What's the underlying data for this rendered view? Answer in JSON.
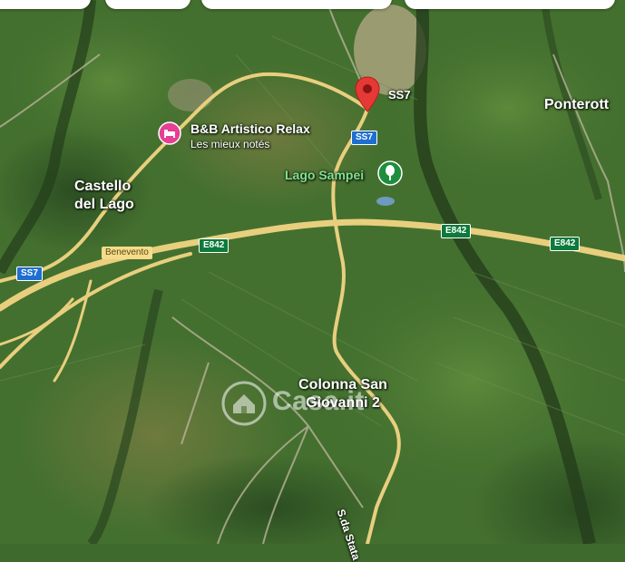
{
  "map": {
    "place_labels": {
      "castello_line1": "Castello",
      "castello_line2": "del Lago",
      "ponterotto": "Ponterott",
      "colonna_line1": "Colonna San",
      "colonna_line2": "Giovanni 2"
    },
    "road_shields": {
      "ss7_top": "SS7",
      "ss7_mid": "SS7",
      "ss7_left": "SS7",
      "e842_a": "E842",
      "e842_b": "E842",
      "e842_c": "E842"
    },
    "city_tag": "Benevento",
    "street_label": "S.da Stata",
    "poi": {
      "name": "B&B Artistico Relax",
      "subtitle": "Les mieux notés"
    },
    "lake": "Lago Sampei",
    "pin_label": "SS7",
    "watermark": "Casa.it",
    "colors": {
      "road": "#e8cf7e",
      "pin": "#e53935",
      "poi_pink": "#e63f93",
      "park_green": "#1e8e3e",
      "e_shield": "#0d7a3c",
      "ss_shield": "#1e6fd0"
    },
    "icons": {
      "pin": "map-pin-icon",
      "poi": "hotel-bed-icon",
      "lake": "park-icon",
      "watermark": "house-logo-icon"
    }
  }
}
